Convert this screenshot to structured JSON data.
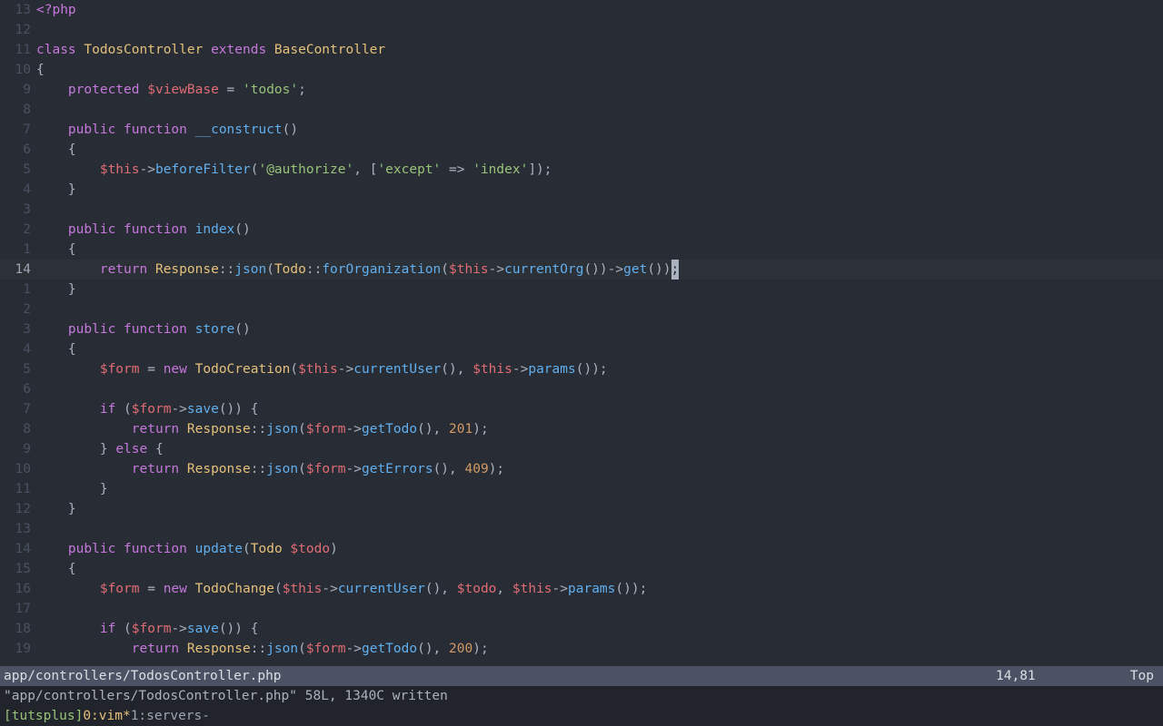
{
  "gutter": [
    "13",
    "12",
    "11",
    "10",
    "9",
    "8",
    "7",
    "6",
    "5",
    "4",
    "3",
    "2",
    "1",
    "14",
    "1",
    "2",
    "3",
    "4",
    "5",
    "6",
    "7",
    "8",
    "9",
    "10",
    "11",
    "12",
    "13",
    "14",
    "15",
    "16",
    "17",
    "18",
    "19"
  ],
  "current_line_index": 13,
  "code": [
    [
      [
        "kw",
        "<?php"
      ]
    ],
    [],
    [
      [
        "kw",
        "class "
      ],
      [
        "cls",
        "TodosController"
      ],
      [
        "plain",
        " "
      ],
      [
        "kw",
        "extends"
      ],
      [
        "plain",
        " "
      ],
      [
        "cls",
        "BaseController"
      ]
    ],
    [
      [
        "punc",
        "{"
      ]
    ],
    [
      [
        "plain",
        "    "
      ],
      [
        "kw",
        "protected"
      ],
      [
        "plain",
        " "
      ],
      [
        "var",
        "$viewBase"
      ],
      [
        "plain",
        " "
      ],
      [
        "op",
        "="
      ],
      [
        "plain",
        " "
      ],
      [
        "str",
        "'todos'"
      ],
      [
        "punc",
        ";"
      ]
    ],
    [],
    [
      [
        "plain",
        "    "
      ],
      [
        "kw",
        "public"
      ],
      [
        "plain",
        " "
      ],
      [
        "kw",
        "function"
      ],
      [
        "plain",
        " "
      ],
      [
        "fn",
        "__construct"
      ],
      [
        "punc",
        "()"
      ]
    ],
    [
      [
        "plain",
        "    "
      ],
      [
        "punc",
        "{"
      ]
    ],
    [
      [
        "plain",
        "        "
      ],
      [
        "var",
        "$this"
      ],
      [
        "op",
        "->"
      ],
      [
        "fn",
        "beforeFilter"
      ],
      [
        "punc",
        "("
      ],
      [
        "str",
        "'@authorize'"
      ],
      [
        "punc",
        ", ["
      ],
      [
        "str",
        "'except'"
      ],
      [
        "plain",
        " "
      ],
      [
        "op",
        "=>"
      ],
      [
        "plain",
        " "
      ],
      [
        "str",
        "'index'"
      ],
      [
        "punc",
        "]);"
      ]
    ],
    [
      [
        "plain",
        "    "
      ],
      [
        "punc",
        "}"
      ]
    ],
    [],
    [
      [
        "plain",
        "    "
      ],
      [
        "kw",
        "public"
      ],
      [
        "plain",
        " "
      ],
      [
        "kw",
        "function"
      ],
      [
        "plain",
        " "
      ],
      [
        "fn",
        "index"
      ],
      [
        "punc",
        "()"
      ]
    ],
    [
      [
        "plain",
        "    "
      ],
      [
        "punc",
        "{"
      ]
    ],
    [
      [
        "plain",
        "        "
      ],
      [
        "kw",
        "return"
      ],
      [
        "plain",
        " "
      ],
      [
        "cls",
        "Response"
      ],
      [
        "op",
        "::"
      ],
      [
        "fn",
        "json"
      ],
      [
        "punc",
        "("
      ],
      [
        "cls",
        "Todo"
      ],
      [
        "op",
        "::"
      ],
      [
        "fn",
        "forOrganization"
      ],
      [
        "punc",
        "("
      ],
      [
        "var",
        "$this"
      ],
      [
        "op",
        "->"
      ],
      [
        "fn",
        "currentOrg"
      ],
      [
        "punc",
        "())"
      ],
      [
        "op",
        "->"
      ],
      [
        "fn",
        "get"
      ],
      [
        "punc",
        "())"
      ],
      [
        "cursor",
        ";"
      ]
    ],
    [
      [
        "plain",
        "    "
      ],
      [
        "punc",
        "}"
      ]
    ],
    [],
    [
      [
        "plain",
        "    "
      ],
      [
        "kw",
        "public"
      ],
      [
        "plain",
        " "
      ],
      [
        "kw",
        "function"
      ],
      [
        "plain",
        " "
      ],
      [
        "fn",
        "store"
      ],
      [
        "punc",
        "()"
      ]
    ],
    [
      [
        "plain",
        "    "
      ],
      [
        "punc",
        "{"
      ]
    ],
    [
      [
        "plain",
        "        "
      ],
      [
        "var",
        "$form"
      ],
      [
        "plain",
        " "
      ],
      [
        "op",
        "="
      ],
      [
        "plain",
        " "
      ],
      [
        "kw",
        "new"
      ],
      [
        "plain",
        " "
      ],
      [
        "cls",
        "TodoCreation"
      ],
      [
        "punc",
        "("
      ],
      [
        "var",
        "$this"
      ],
      [
        "op",
        "->"
      ],
      [
        "fn",
        "currentUser"
      ],
      [
        "punc",
        "(), "
      ],
      [
        "var",
        "$this"
      ],
      [
        "op",
        "->"
      ],
      [
        "fn",
        "params"
      ],
      [
        "punc",
        "());"
      ]
    ],
    [],
    [
      [
        "plain",
        "        "
      ],
      [
        "kw",
        "if"
      ],
      [
        "plain",
        " ("
      ],
      [
        "var",
        "$form"
      ],
      [
        "op",
        "->"
      ],
      [
        "fn",
        "save"
      ],
      [
        "punc",
        "()) {"
      ]
    ],
    [
      [
        "plain",
        "            "
      ],
      [
        "kw",
        "return"
      ],
      [
        "plain",
        " "
      ],
      [
        "cls",
        "Response"
      ],
      [
        "op",
        "::"
      ],
      [
        "fn",
        "json"
      ],
      [
        "punc",
        "("
      ],
      [
        "var",
        "$form"
      ],
      [
        "op",
        "->"
      ],
      [
        "fn",
        "getTodo"
      ],
      [
        "punc",
        "(), "
      ],
      [
        "num",
        "201"
      ],
      [
        "punc",
        ");"
      ]
    ],
    [
      [
        "plain",
        "        "
      ],
      [
        "punc",
        "} "
      ],
      [
        "kw",
        "else"
      ],
      [
        "punc",
        " {"
      ]
    ],
    [
      [
        "plain",
        "            "
      ],
      [
        "kw",
        "return"
      ],
      [
        "plain",
        " "
      ],
      [
        "cls",
        "Response"
      ],
      [
        "op",
        "::"
      ],
      [
        "fn",
        "json"
      ],
      [
        "punc",
        "("
      ],
      [
        "var",
        "$form"
      ],
      [
        "op",
        "->"
      ],
      [
        "fn",
        "getErrors"
      ],
      [
        "punc",
        "(), "
      ],
      [
        "num",
        "409"
      ],
      [
        "punc",
        ");"
      ]
    ],
    [
      [
        "plain",
        "        "
      ],
      [
        "punc",
        "}"
      ]
    ],
    [
      [
        "plain",
        "    "
      ],
      [
        "punc",
        "}"
      ]
    ],
    [],
    [
      [
        "plain",
        "    "
      ],
      [
        "kw",
        "public"
      ],
      [
        "plain",
        " "
      ],
      [
        "kw",
        "function"
      ],
      [
        "plain",
        " "
      ],
      [
        "fn",
        "update"
      ],
      [
        "punc",
        "("
      ],
      [
        "cls",
        "Todo"
      ],
      [
        "plain",
        " "
      ],
      [
        "var",
        "$todo"
      ],
      [
        "punc",
        ")"
      ]
    ],
    [
      [
        "plain",
        "    "
      ],
      [
        "punc",
        "{"
      ]
    ],
    [
      [
        "plain",
        "        "
      ],
      [
        "var",
        "$form"
      ],
      [
        "plain",
        " "
      ],
      [
        "op",
        "="
      ],
      [
        "plain",
        " "
      ],
      [
        "kw",
        "new"
      ],
      [
        "plain",
        " "
      ],
      [
        "cls",
        "TodoChange"
      ],
      [
        "punc",
        "("
      ],
      [
        "var",
        "$this"
      ],
      [
        "op",
        "->"
      ],
      [
        "fn",
        "currentUser"
      ],
      [
        "punc",
        "(), "
      ],
      [
        "var",
        "$todo"
      ],
      [
        "punc",
        ", "
      ],
      [
        "var",
        "$this"
      ],
      [
        "op",
        "->"
      ],
      [
        "fn",
        "params"
      ],
      [
        "punc",
        "());"
      ]
    ],
    [],
    [
      [
        "plain",
        "        "
      ],
      [
        "kw",
        "if"
      ],
      [
        "plain",
        " ("
      ],
      [
        "var",
        "$form"
      ],
      [
        "op",
        "->"
      ],
      [
        "fn",
        "save"
      ],
      [
        "punc",
        "()) {"
      ]
    ],
    [
      [
        "plain",
        "            "
      ],
      [
        "kw",
        "return"
      ],
      [
        "plain",
        " "
      ],
      [
        "cls",
        "Response"
      ],
      [
        "op",
        "::"
      ],
      [
        "fn",
        "json"
      ],
      [
        "punc",
        "("
      ],
      [
        "var",
        "$form"
      ],
      [
        "op",
        "->"
      ],
      [
        "fn",
        "getTodo"
      ],
      [
        "punc",
        "(), "
      ],
      [
        "num",
        "200"
      ],
      [
        "punc",
        ");"
      ]
    ]
  ],
  "status": {
    "file": "app/controllers/TodosController.php",
    "position": "14,81",
    "scroll": "Top"
  },
  "message": "\"app/controllers/TodosController.php\" 58L, 1340C written",
  "tmux": {
    "session": "[tutsplus]",
    "win0": " 0:vim*",
    "win1": " 1:servers-"
  }
}
